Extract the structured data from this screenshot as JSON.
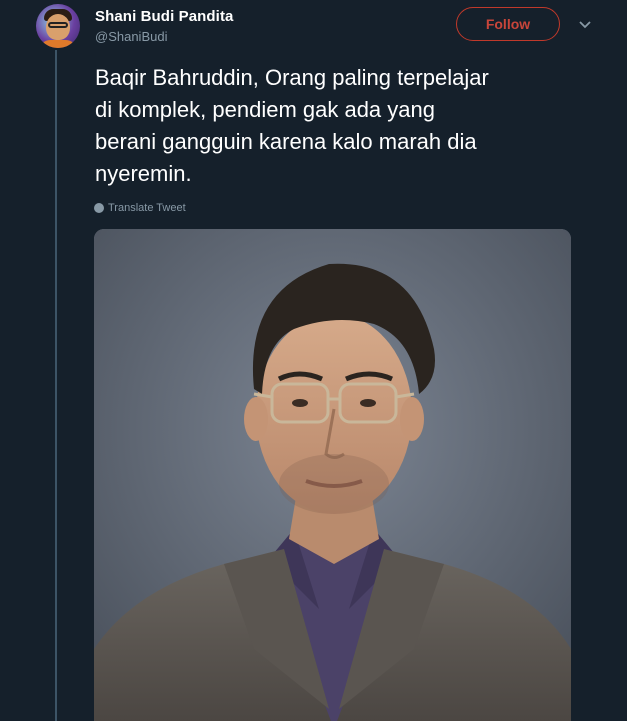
{
  "tweet": {
    "display_name": "Shani Budi Pandita",
    "handle": "@ShaniBudi",
    "follow_label": "Follow",
    "text_lines": [
      "Baqir Bahruddin, Orang paling terpelajar",
      "di komplek, pendiem gak ada yang",
      "berani gangguin karena kalo marah dia",
      "nyeremin."
    ],
    "translate_label": "Translate Tweet",
    "follow_color": "#c0392b",
    "background_color": "#15202b"
  },
  "icons": {
    "caret": "chevron-down-icon",
    "translate": "globe-icon",
    "avatar": "avatar"
  }
}
